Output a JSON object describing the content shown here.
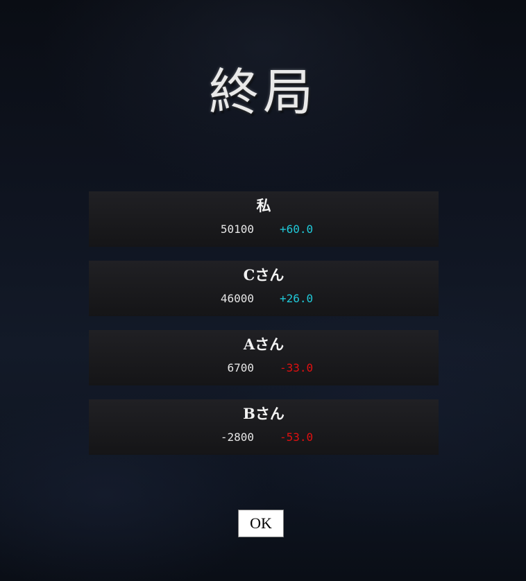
{
  "title": "終局",
  "results": [
    {
      "name": "私",
      "score": "50100",
      "delta": "+60.0",
      "delta_color": "#20c8d8"
    },
    {
      "name": "Cさん",
      "score": "46000",
      "delta": "+26.0",
      "delta_color": "#20c8d8"
    },
    {
      "name": "Aさん",
      "score": "6700",
      "delta": "-33.0",
      "delta_color": "#e01010"
    },
    {
      "name": "Bさん",
      "score": "-2800",
      "delta": "-53.0",
      "delta_color": "#e01010"
    }
  ],
  "ok_label": "OK",
  "colors": {
    "positive": "#20c8d8",
    "negative": "#e01010",
    "background": "#0c1018"
  }
}
